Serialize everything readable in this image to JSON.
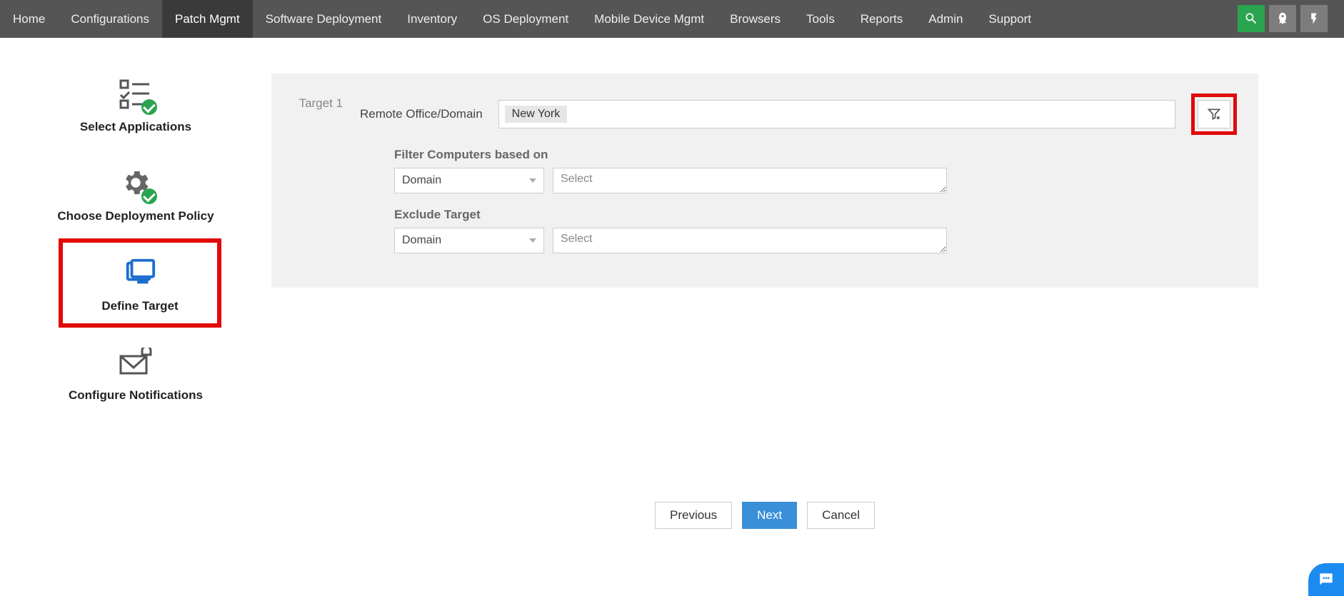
{
  "nav": {
    "items": [
      {
        "label": "Home"
      },
      {
        "label": "Configurations"
      },
      {
        "label": "Patch Mgmt"
      },
      {
        "label": "Software Deployment"
      },
      {
        "label": "Inventory"
      },
      {
        "label": "OS Deployment"
      },
      {
        "label": "Mobile Device Mgmt"
      },
      {
        "label": "Browsers"
      },
      {
        "label": "Tools"
      },
      {
        "label": "Reports"
      },
      {
        "label": "Admin"
      },
      {
        "label": "Support"
      }
    ],
    "active_index": 2
  },
  "wizard": {
    "steps": [
      {
        "label": "Select Applications",
        "completed": true
      },
      {
        "label": "Choose Deployment Policy",
        "completed": true
      },
      {
        "label": "Define Target",
        "active": true
      },
      {
        "label": "Configure Notifications"
      }
    ]
  },
  "target": {
    "heading": "Target 1",
    "remote_office_label": "Remote Office/Domain",
    "remote_office_chip": "New York",
    "filter_section_label": "Filter Computers based on",
    "filter_by_value": "Domain",
    "filter_placeholder": "Select",
    "exclude_section_label": "Exclude Target",
    "exclude_by_value": "Domain",
    "exclude_placeholder": "Select"
  },
  "buttons": {
    "previous": "Previous",
    "next": "Next",
    "cancel": "Cancel"
  }
}
